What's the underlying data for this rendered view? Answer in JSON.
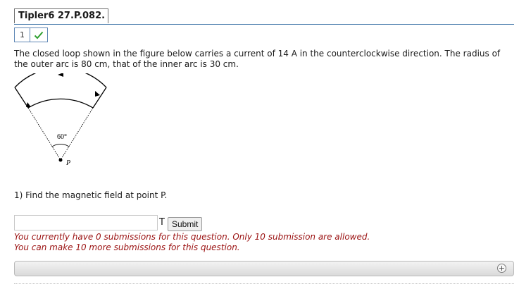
{
  "header": {
    "title": "Tipler6 27.P.082."
  },
  "status": {
    "number": "1",
    "icon": "checkmark-icon",
    "check_color": "#2ea02e"
  },
  "question": {
    "text": "The closed loop shown in the figure below carries a current of 14 A in the counterclockwise direction. The radius of the outer arc is 80 cm, that of the inner arc is 30 cm."
  },
  "figure": {
    "angle_label": "60°",
    "point_label": "P"
  },
  "part": {
    "prompt": "1) Find the magnetic field at point P."
  },
  "answer": {
    "value": "",
    "unit": "T",
    "submit_label": "Submit"
  },
  "messages": {
    "submissions": "You currently have 0 submissions for this question. Only 10 submission are allowed.",
    "remaining": "You can make 10 more submissions for this question."
  },
  "colors": {
    "accent_rule": "#3e74a8",
    "error_text": "#9a1010"
  }
}
